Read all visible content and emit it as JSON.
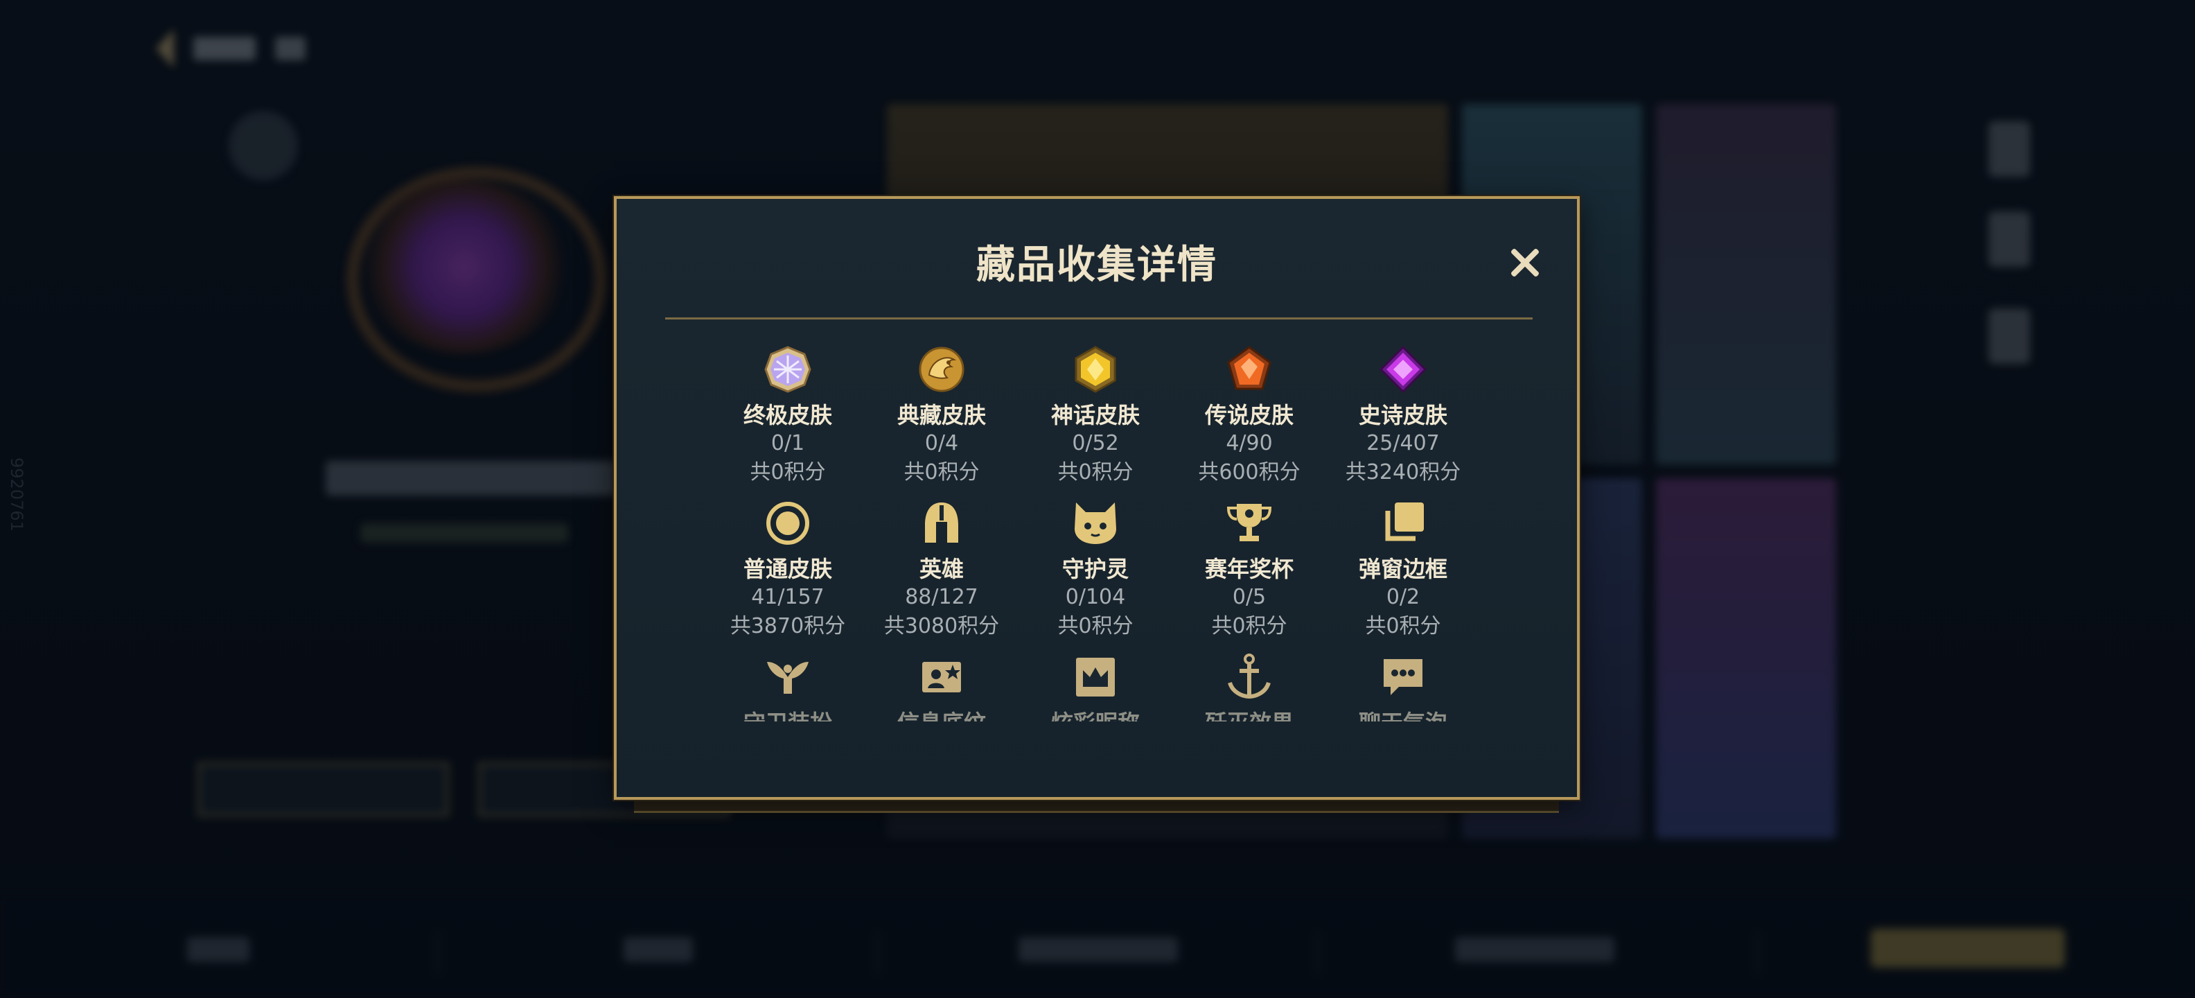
{
  "modal": {
    "title": "藏品收集详情",
    "close_label": "close"
  },
  "colors": {
    "border_gold": "#b8995a",
    "label": "#f1e8d2",
    "muted": "#a9b0b4",
    "icon_gold": "#e2c77a"
  },
  "background": {
    "side_vertical_text": "9920761"
  },
  "categories": [
    {
      "label": "终极皮肤",
      "count": "0/1",
      "points": "共0积分",
      "icon": "ultimate-gem-icon"
    },
    {
      "label": "典藏皮肤",
      "count": "0/4",
      "points": "共0积分",
      "icon": "legendary-dragon-icon"
    },
    {
      "label": "神话皮肤",
      "count": "0/52",
      "points": "共0积分",
      "icon": "mythic-gem-icon"
    },
    {
      "label": "传说皮肤",
      "count": "4/90",
      "points": "共600积分",
      "icon": "legend-gem-icon"
    },
    {
      "label": "史诗皮肤",
      "count": "25/407",
      "points": "共3240积分",
      "icon": "epic-gem-icon"
    },
    {
      "label": "普通皮肤",
      "count": "41/157",
      "points": "共3870积分",
      "icon": "normal-circle-icon"
    },
    {
      "label": "英雄",
      "count": "88/127",
      "points": "共3080积分",
      "icon": "helmet-icon"
    },
    {
      "label": "守护灵",
      "count": "0/104",
      "points": "共0积分",
      "icon": "pet-cat-icon"
    },
    {
      "label": "赛年奖杯",
      "count": "0/5",
      "points": "共0积分",
      "icon": "trophy-icon"
    },
    {
      "label": "弹窗边框",
      "count": "0/2",
      "points": "共0积分",
      "icon": "frames-icon"
    },
    {
      "label": "守卫装扮",
      "icon": "ward-icon"
    },
    {
      "label": "信息底纹",
      "icon": "profile-card-icon"
    },
    {
      "label": "炫彩昵称",
      "icon": "crown-nameplate-icon"
    },
    {
      "label": "歼灭效果",
      "icon": "anchor-icon"
    },
    {
      "label": "聊天气泡",
      "icon": "chat-bubble-icon"
    }
  ]
}
